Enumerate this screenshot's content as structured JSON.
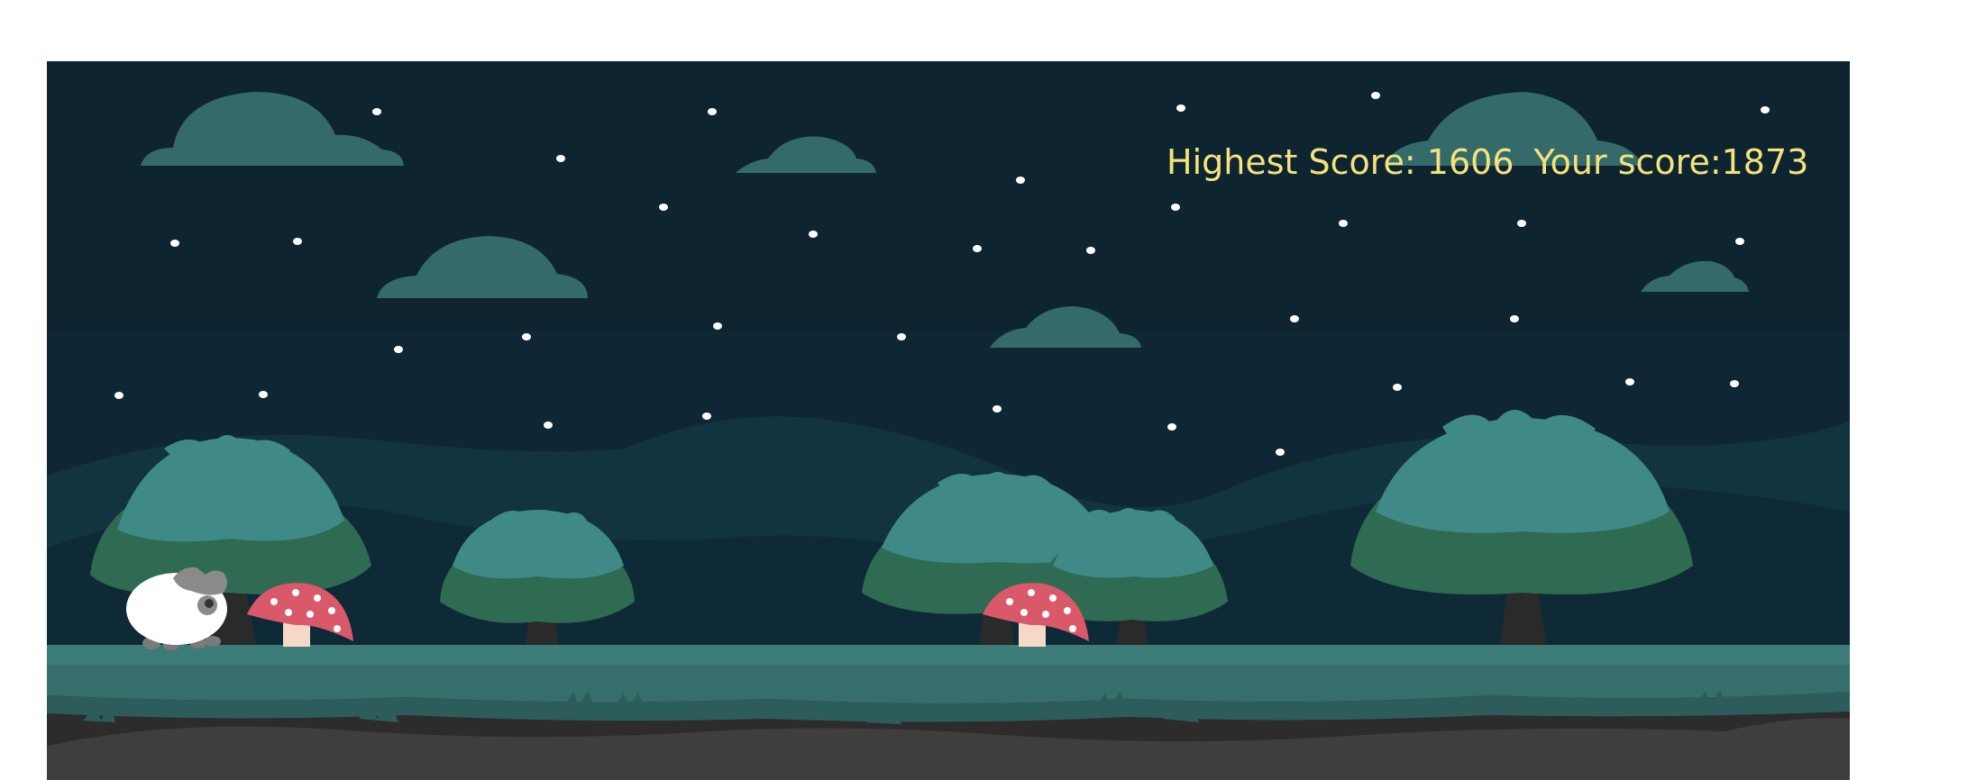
{
  "game": {
    "score": {
      "highest_label": "Highest Score: 1606",
      "current_label": "Your score:1873",
      "color": "#f3e37a"
    },
    "colors": {
      "sky": "#0f2634",
      "cloud": "#356a6a",
      "star": "#ffffff",
      "hill": "#11313f",
      "tree_light": "#3f8a86",
      "tree_dark": "#2f6a52",
      "trunk": "#2a2a2a",
      "grass": "#3c7b78",
      "grass_dark": "#2d5d5a",
      "dirt": "#2e2b2c",
      "dirt_light": "#403d3e",
      "mushroom_cap": "#d9586a",
      "mushroom_stem": "#f5d9c6",
      "sheep_body": "#ffffff",
      "sheep_head": "#8a8a8a"
    },
    "sprites": [
      "sheep-player",
      "mushroom-obstacle",
      "mushroom-obstacle"
    ]
  }
}
